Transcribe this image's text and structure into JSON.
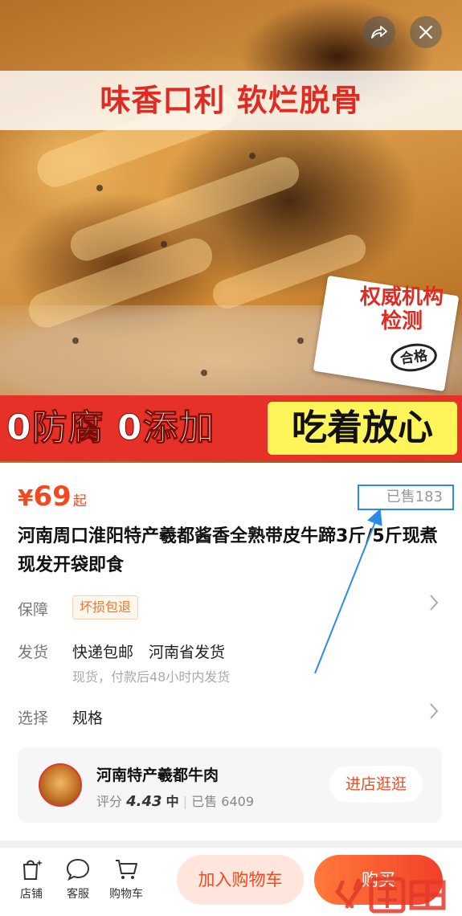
{
  "hero": {
    "banner_top": "味香口利 软烂脱骨",
    "cert_lines": [
      "权威机构",
      "检测"
    ],
    "cert_stamp": "合格",
    "banner_left": "0防腐 0添加",
    "banner_right": "吃着放心"
  },
  "product": {
    "currency": "¥",
    "price": "69",
    "price_suffix": "起",
    "sold": "已售183",
    "title": "河南周口淮阳特产羲都酱香全熟带皮牛蹄3斤/5斤现煮现发开袋即食"
  },
  "rows": {
    "guarantee": {
      "label": "保障",
      "tag": "坏损包退"
    },
    "shipping": {
      "label": "发货",
      "value": "快递包邮　河南省发货",
      "sub": "现货，付款后48小时内发货"
    },
    "option": {
      "label": "选择",
      "value": "规格"
    }
  },
  "shop": {
    "name": "河南特产羲都牛肉",
    "rating_label": "评分",
    "rating_value": "4.43",
    "rating_level": "中",
    "sold": "已售 6409",
    "button": "进店逛逛"
  },
  "bottom_bar": {
    "tabs": [
      {
        "label": "店铺",
        "icon": "store-icon"
      },
      {
        "label": "客服",
        "icon": "chat-icon"
      },
      {
        "label": "购物车",
        "icon": "cart-icon"
      }
    ],
    "add_to_cart": "加入购物车",
    "buy_now": "购买"
  },
  "icons": {
    "share": "share-icon",
    "close": "close-icon",
    "chevron": "chevron-right-icon"
  },
  "colors": {
    "accent": "#f24a1e",
    "annotation": "#2b8be8",
    "banner_red": "#e53127",
    "banner_yellow": "#fff45a"
  }
}
